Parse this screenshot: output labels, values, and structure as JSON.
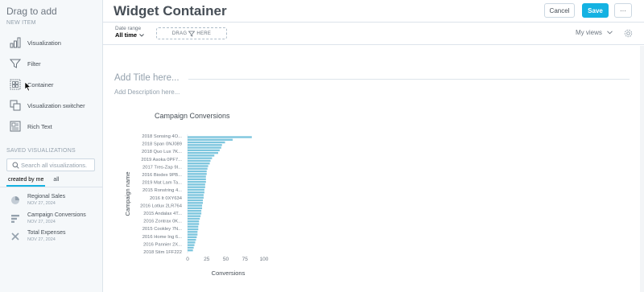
{
  "sidebar": {
    "title": "Drag to add",
    "new_item_label": "NEW ITEM",
    "items": [
      {
        "label": "Visualization",
        "icon": "bar-chart-icon"
      },
      {
        "label": "Filter",
        "icon": "funnel-icon"
      },
      {
        "label": "Container",
        "icon": "container-icon"
      },
      {
        "label": "Visualization switcher",
        "icon": "switcher-icon"
      },
      {
        "label": "Rich Text",
        "icon": "rich-text-icon"
      }
    ],
    "saved_label": "SAVED VISUALIZATIONS",
    "search_placeholder": "Search all visualizations.",
    "tabs": [
      "created by me",
      "all"
    ],
    "saved": [
      {
        "name": "Regional Sales",
        "date": "NOV 27, 2024",
        "icon": "pie-chart-icon"
      },
      {
        "name": "Campaign Conversions",
        "date": "NOV 27, 2024",
        "icon": "bar-chart-horizontal-icon"
      },
      {
        "name": "Total Expenses",
        "date": "NOV 27, 2024",
        "icon": "cross-icon"
      }
    ]
  },
  "header": {
    "title": "Widget Container",
    "cancel_label": "Cancel",
    "save_label": "Save",
    "more_label": "···",
    "accent": "#14b2e2"
  },
  "filterbar": {
    "date_label": "Date range",
    "date_value": "All time",
    "drag_label": "DRAG",
    "drag_label_here": "HERE",
    "views_label": "My views"
  },
  "canvas": {
    "add_title": "Add Title here...",
    "add_description": "Add Description here..."
  },
  "chart_data": {
    "type": "bar",
    "orientation": "horizontal",
    "title": "Campaign Conversions",
    "xlabel": "Conversions",
    "ylabel": "Campaign name",
    "xlim": [
      0,
      100
    ],
    "xticks": [
      0,
      25,
      50,
      75,
      100
    ],
    "color": "#7dc6de",
    "tick_labels": [
      "2018 Sonsing 4O...",
      "2018 Span 0NJ089",
      "2018 Quo Lux 7K...",
      "2019 Asoka 0PF7...",
      "2017 Tres-Zap 9I...",
      "2016 Biodex 9PB...",
      "2019 Mat Lam Ta...",
      "2015 Ronstring 4...",
      "2016 It 0XY634",
      "2016 Lotlux 2LR764",
      "2015 Andalax 4T...",
      "2016 Zontrax 0K...",
      "2015 Cookley 7N...",
      "2016 Home Ing 6...",
      "2016 Pannier 2X...",
      "2018 Stim 1FF222"
    ],
    "values": [
      84,
      59,
      49,
      45,
      44,
      42,
      40,
      35,
      32,
      30,
      29,
      27,
      26,
      25,
      25,
      24,
      24,
      24,
      23,
      23,
      22,
      22,
      21,
      21,
      20,
      20,
      19,
      19,
      18,
      18,
      17,
      16,
      15,
      15,
      14,
      14,
      13,
      13,
      12,
      11,
      10,
      9,
      8,
      7
    ]
  }
}
